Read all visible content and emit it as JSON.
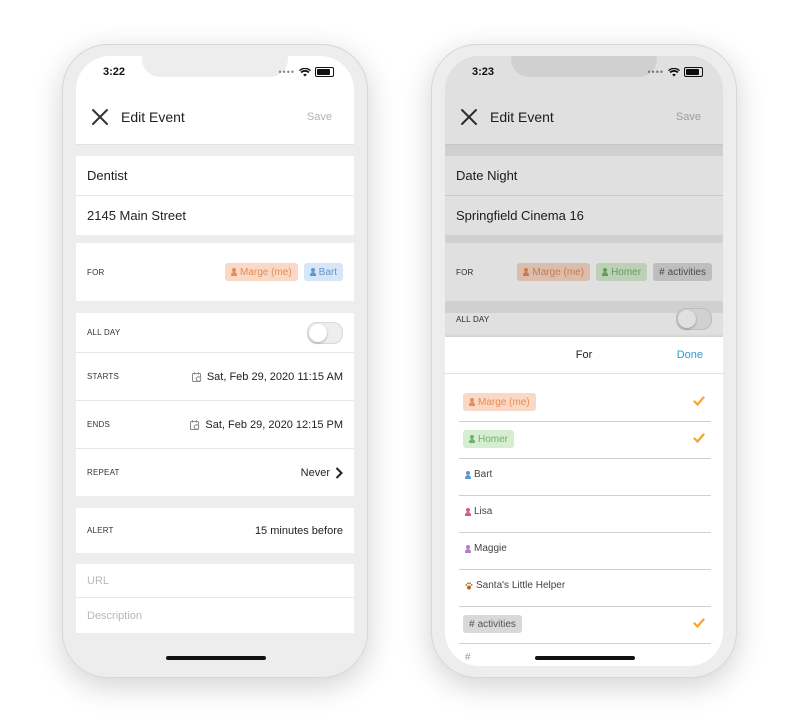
{
  "phone1": {
    "time": "3:22",
    "nav_title": "Edit Event",
    "save_label": "Save",
    "title_value": "Dentist",
    "location_value": "2145 Main Street",
    "for_label": "FOR",
    "for_chips": [
      "Marge (me)",
      "Bart"
    ],
    "allday_label": "ALL DAY",
    "starts_label": "STARTS",
    "starts_value": "Sat, Feb 29, 2020  11:15 AM",
    "ends_label": "ENDS",
    "ends_value": "Sat, Feb 29, 2020  12:15 PM",
    "repeat_label": "REPEAT",
    "repeat_value": "Never",
    "alert_label": "ALERT",
    "alert_value": "15 minutes before",
    "url_placeholder": "URL",
    "description_placeholder": "Description"
  },
  "phone2": {
    "time": "3:23",
    "nav_title": "Edit Event",
    "save_label": "Save",
    "title_value": "Date Night",
    "location_value": "Springfield Cinema 16",
    "for_label": "FOR",
    "for_chips": [
      "Marge (me)",
      "Homer",
      "activities"
    ],
    "allday_label": "ALL DAY",
    "sheet_title": "For",
    "sheet_done": "Done",
    "options": [
      "Marge (me)",
      "Homer",
      "Bart",
      "Lisa",
      "Maggie",
      "Santa's Little Helper",
      "activities"
    ]
  },
  "colors": {
    "orange": "#e88c56",
    "blue": "#5f97cf",
    "green": "#6db465",
    "pink": "#d95a7a",
    "purple": "#b07cc6",
    "brown": "#b5651d",
    "check": "#f4a631",
    "done": "#2a9ad6"
  }
}
